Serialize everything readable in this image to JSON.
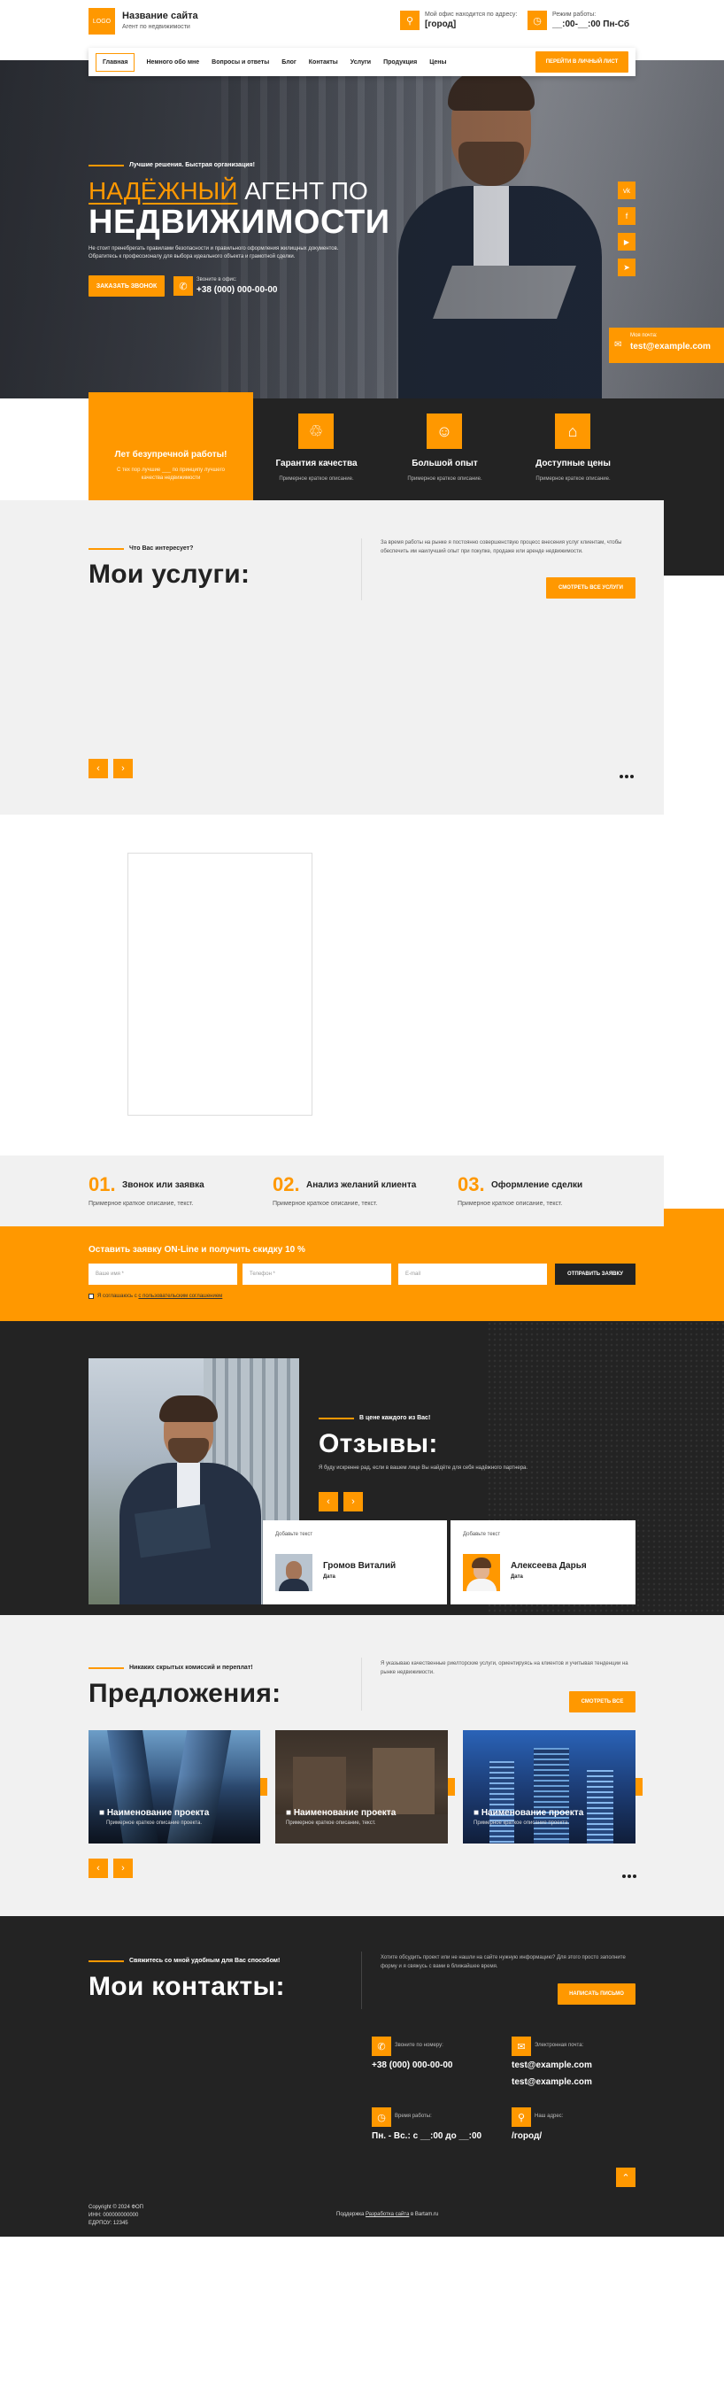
{
  "header": {
    "logo": "LOGO",
    "site_title": "Название сайта",
    "site_subtitle": "Агент по недвижимости",
    "office_label": "Мой офис находится по адресу:",
    "office_value": "[город]",
    "hours_label": "Режим работы:",
    "hours_value": "__:00-__:00 Пн-Сб"
  },
  "nav": {
    "items": [
      "Главная",
      "Немного обо мне",
      "Вопросы и ответы",
      "Блог",
      "Контакты",
      "Услуги",
      "Продукция",
      "Цены"
    ],
    "cta": "ПЕРЕЙТИ В ЛИЧНЫЙ ЛИСТ"
  },
  "hero": {
    "eyebrow": "Лучшие решения. Быстрая организация!",
    "title_accent": "НАДЁЖНЫЙ",
    "title_rest": " АГЕНТ ПО",
    "title_line2": "НЕДВИЖИМОСТИ",
    "desc": "Не стоит пренебрегать правилами безопасности и правильного оформления жилищных документов. Обратитесь к профессионалу для выбора идеального объекта и грамотной сделки.",
    "order_btn": "ЗАКАЗАТЬ ЗВОНОК",
    "phone_label": "Звоните в офис:",
    "phone_value": "+38 (000) 000-00-00",
    "email_label": "Моя почта:",
    "email_value": "test@example.com"
  },
  "features": {
    "badge_title": "Лет безупречной работы!",
    "badge_desc": "С тех пор лучшие ___ по принципу лучшего качества недвижимости",
    "items": [
      {
        "title": "Гарантия качества",
        "desc": "Примерное краткое описание."
      },
      {
        "title": "Большой опыт",
        "desc": "Примерное краткое описание."
      },
      {
        "title": "Доступные цены",
        "desc": "Примерное краткое описание."
      }
    ]
  },
  "services": {
    "eyebrow": "Что Вас интересует?",
    "title": "Мои услуги:",
    "desc": "За время работы на рынке я постоянно совершенствую процесс внесения услуг клиентам, чтобы обеспечить им наилучший опыт при покупке, продаже или аренде недвижимости.",
    "btn": "СМОТРЕТЬ ВСЕ УСЛУГИ",
    "prev": "‹",
    "next": "›"
  },
  "steps": [
    {
      "num": "01.",
      "title": "Звонок или заявка",
      "desc": "Примерное краткое описание, текст."
    },
    {
      "num": "02.",
      "title": "Анализ желаний клиента",
      "desc": "Примерное краткое описание, текст."
    },
    {
      "num": "03.",
      "title": "Оформление сделки",
      "desc": "Примерное краткое описание, текст."
    }
  ],
  "request": {
    "title": "Оставить заявку ON-Line и получить скидку 10 %",
    "name_ph": "Ваше имя *",
    "phone_ph": "Телефон *",
    "email_ph": "E-mail",
    "btn": "ОТПРАВИТЬ ЗАЯВКУ",
    "consent": "Я соглашаюсь с",
    "consent_link": "с пользовательским соглашением"
  },
  "reviews": {
    "eyebrow": "В цене каждого из Вас!",
    "title": "Отзывы:",
    "desc": "Я буду искренне рад, если в вашем лице Вы найдёте для себя надёжного партнера.",
    "cards": [
      {
        "label": "Добавьте текст",
        "name": "Громов Виталий",
        "date": "Дата"
      },
      {
        "label": "Добавьте текст",
        "name": "Алексеева Дарья",
        "date": "Дата"
      }
    ]
  },
  "offers": {
    "eyebrow": "Никаких скрытых комиссий и переплат!",
    "title": "Предложения:",
    "desc": "Я указываю качественные риелторские услуги, ориентируясь на клиентов и учитывая тенденции на рынке недвижимости.",
    "btn": "СМОТРЕТЬ ВСЕ",
    "cards": [
      {
        "title": "Наименование проекта",
        "desc": "Примерное краткое описание проекта."
      },
      {
        "title": "Наименование проекта",
        "desc": "Примерное краткое описание, текст."
      },
      {
        "title": "Наименование проекта",
        "desc": "Примерное краткое описание проекта."
      }
    ]
  },
  "contacts": {
    "eyebrow": "Свяжитесь со мной удобным для Вас способом!",
    "title": "Мои контакты:",
    "desc": "Хотите обсудить проект или не нашли на сайте нужную информацию? Для этого просто заполните форму и я свяжусь с вами в ближайшее время.",
    "btn": "НАПИСАТЬ ПИСЬМО",
    "phone_label": "Звоните по номеру:",
    "phone_value": "+38 (000) 000-00-00",
    "email_label": "Электронная почта:",
    "email_value1": "test@example.com",
    "email_value2": "test@example.com",
    "hours_label": "Время работы:",
    "hours_value": "Пн. - Вс.: с __:00 до __:00",
    "addr_label": "Наш адрес:",
    "addr_value": "/город/"
  },
  "footer": {
    "copyright": "Copyright © 2024 ФОП",
    "inn": "ИНН: 000000000000",
    "edrpou": "ЕДРПОУ: 12345",
    "credit_prefix": "Поддержка ",
    "credit_link": "Разработка сайта",
    "credit_suffix": " в Bartam.ru"
  }
}
